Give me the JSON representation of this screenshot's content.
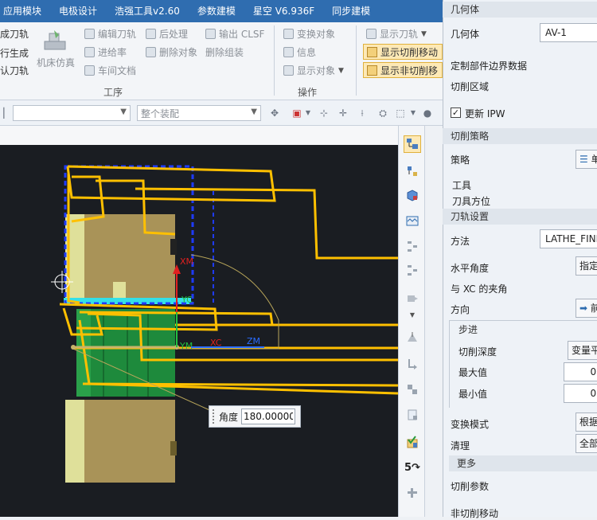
{
  "menu": [
    "应用模块",
    "电极设计",
    "浩强工具v2.60",
    "参数建模",
    "星空 V6.936F",
    "同步建模"
  ],
  "ribbon": {
    "left_partial": [
      "成刀轨",
      "行生成",
      "认刀轨"
    ],
    "sim_label": "机床仿真",
    "col1": [
      "编辑刀轨",
      "进给率",
      "车间文档"
    ],
    "col2": [
      "后处理",
      "删除对象"
    ],
    "col3": [
      "输出 CLSF",
      "删除组装"
    ],
    "group_label_process": "工序",
    "col4": [
      "变换对象",
      "信息",
      "显示对象"
    ],
    "group_label_ops": "操作",
    "show_toolpath": "显示刀轨",
    "show_cut_move": "显示切削移动",
    "show_noncut_move": "显示非切削移"
  },
  "selbar": {
    "filter_value": "",
    "scope_value": "整个装配"
  },
  "viewport": {
    "angle_label": "角度",
    "angle_value": "180.00000",
    "axis_labels": [
      "XM",
      "YC",
      "YM",
      "XC",
      "ZM"
    ]
  },
  "panel": {
    "geometry_head": "几何体",
    "geometry_label": "几何体",
    "geometry_value": "AV-1",
    "custom_boundary": "定制部件边界数据",
    "cut_region": "切削区域",
    "update_ipw": "更新 IPW",
    "update_ipw_checked": true,
    "cut_strategy_head": "切削策略",
    "strategy_label": "策略",
    "strategy_value": "单",
    "tool": "工具",
    "tool_orient": "刀具方位",
    "toolpath_settings": "刀轨设置",
    "method_label": "方法",
    "method_value": "LATHE_FINI",
    "horiz_angle_label": "水平角度",
    "horiz_angle_value": "指定",
    "xc_angle_label": "与 XC 的夹角",
    "direction_label": "方向",
    "direction_value": "前",
    "step_head": "步进",
    "cut_depth_label": "切削深度",
    "cut_depth_value": "变量平",
    "max_label": "最大值",
    "max_value": "0.",
    "min_label": "最小值",
    "min_value": "0.",
    "transform_label": "变换模式",
    "transform_value": "根据",
    "cleanup_label": "清理",
    "cleanup_value": "全部",
    "more": "更多",
    "cut_params": "切削参数",
    "noncut_moves": "非切削移动"
  },
  "colors": {
    "menubar": "#2f6db0",
    "toolpath": "#ffc000",
    "part_tan": "#a99358",
    "part_green": "#1e8a3c",
    "highlight_button": "#fde9b6",
    "viewport_bg": "#1a1d22"
  }
}
